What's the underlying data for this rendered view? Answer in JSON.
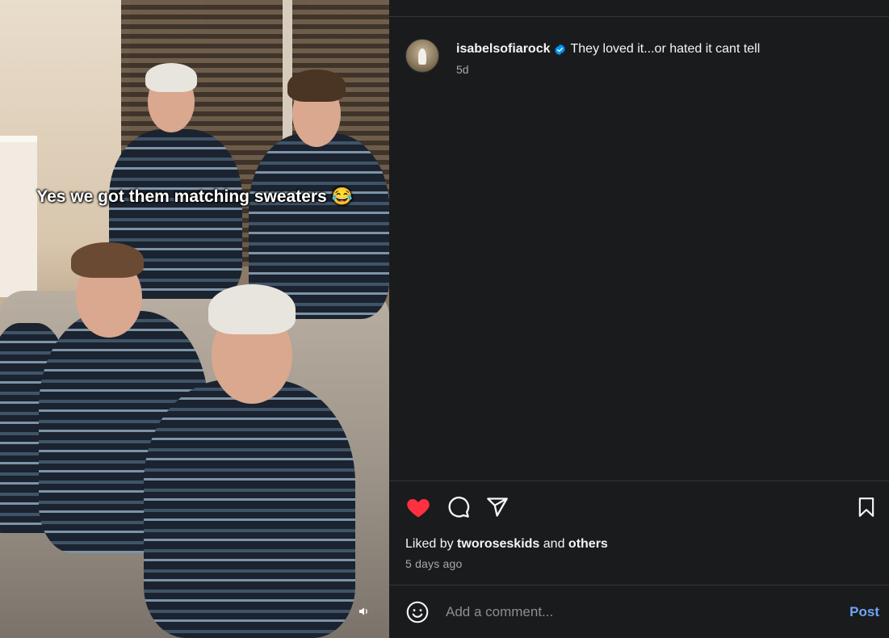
{
  "video": {
    "overlay_caption": "Yes we got them matching sweaters 😂",
    "volume_icon": "speaker-icon"
  },
  "post": {
    "username": "isabelsofiarock",
    "verified": true,
    "caption": "They loved it...or hated it cant tell",
    "time_ago": "5d"
  },
  "actions": {
    "like_icon": "heart-filled-icon",
    "comment_icon": "comment-icon",
    "share_icon": "send-icon",
    "save_icon": "bookmark-icon",
    "like_color": "#ff3040"
  },
  "likes": {
    "prefix": "Liked by",
    "user": "tworoseskids",
    "and": "and",
    "others": "others"
  },
  "date": "5 days ago",
  "comment": {
    "placeholder": "Add a comment...",
    "post_label": "Post",
    "emoji_icon": "smiley-icon"
  },
  "colors": {
    "panel_bg": "#1a1b1d",
    "divider": "#363636",
    "secondary_text": "#a8a8a8",
    "verified_blue": "#0095f6",
    "post_button": "#6ea5f5"
  }
}
